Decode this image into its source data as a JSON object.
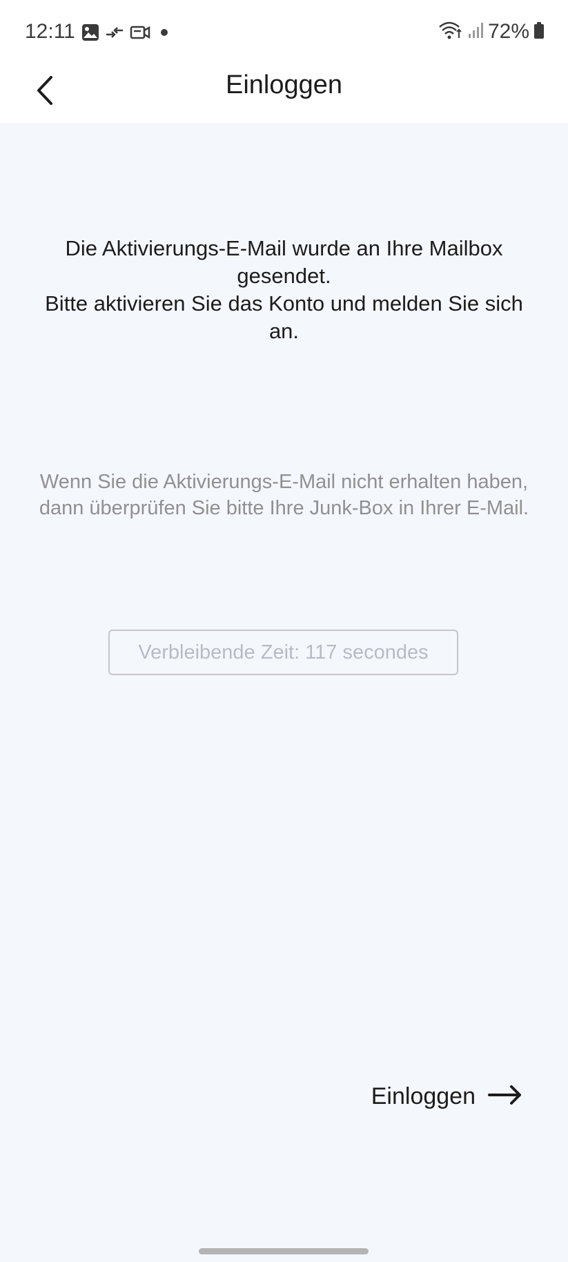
{
  "status_bar": {
    "time": "12:11",
    "battery": "72%",
    "left_icons": [
      "image-icon",
      "transfer-icon",
      "video-call-icon",
      "dot-icon"
    ],
    "right_icons": [
      "wifi-icon",
      "signal-icon",
      "battery-icon"
    ]
  },
  "header": {
    "title": "Einloggen",
    "back_icon": "chevron-left-icon"
  },
  "message": {
    "line1": "Die Aktivierungs-E-Mail wurde an Ihre Mailbox gesendet.",
    "line2": "Bitte aktivieren Sie das Konto und melden Sie sich an."
  },
  "hint": {
    "line1": "Wenn Sie die Aktivierungs-E-Mail nicht erhalten haben,",
    "line2": "dann überprüfen Sie bitte Ihre Junk-Box in Ihrer E-Mail."
  },
  "countdown": {
    "label": "Verbleibende Zeit: 117 secondes"
  },
  "login_link": {
    "label": "Einloggen",
    "icon": "arrow-right-icon"
  },
  "colors": {
    "background": "#f4f7fc",
    "text_primary": "#1c1c1c",
    "text_hint": "#909090",
    "countdown_text": "#b8bbc4",
    "countdown_border": "#c6c6c6"
  }
}
